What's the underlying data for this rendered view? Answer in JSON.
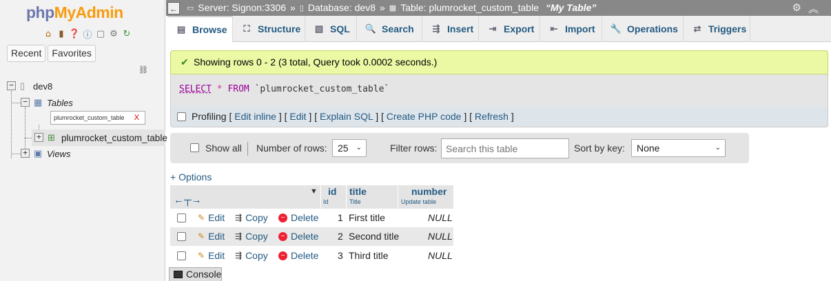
{
  "nav": {
    "logo_a": "php",
    "logo_b": "MyAdmin",
    "icons": [
      "home-icon",
      "logout-icon",
      "help-icon",
      "docs-icon",
      "copy-icon",
      "settings-icon",
      "reload-icon"
    ],
    "tab_recent": "Recent",
    "tab_favorites": "Favorites",
    "tree": {
      "db": "dev8",
      "tables_label": "Tables",
      "filter_value": "plumrocket_custom_table",
      "filter_clear": "X",
      "table_name": "plumrocket_custom_table",
      "views_label": "Views"
    }
  },
  "topbar": {
    "back": "←",
    "server": "Server: Signon:3306",
    "sep": "»",
    "database": "Database: dev8",
    "table": "Table: plumrocket_custom_table",
    "comment": "“My Table”"
  },
  "tabs": [
    {
      "label": "Browse",
      "icon": "browse-icon"
    },
    {
      "label": "Structure",
      "icon": "structure-icon"
    },
    {
      "label": "SQL",
      "icon": "sql-icon"
    },
    {
      "label": "Search",
      "icon": "search-icon"
    },
    {
      "label": "Insert",
      "icon": "insert-icon"
    },
    {
      "label": "Export",
      "icon": "export-icon"
    },
    {
      "label": "Import",
      "icon": "import-icon"
    },
    {
      "label": "Operations",
      "icon": "operations-icon"
    },
    {
      "label": "Triggers",
      "icon": "triggers-icon"
    }
  ],
  "message": "Showing rows 0 - 2 (3 total, Query took 0.0002 seconds.)",
  "sql": {
    "select": "SELECT",
    "star": "*",
    "from": "FROM",
    "table": "`plumrocket_custom_table`"
  },
  "profiling": {
    "label": "Profiling",
    "edit_inline": "Edit inline",
    "edit": "Edit",
    "explain": "Explain SQL",
    "php": "Create PHP code",
    "refresh": "Refresh"
  },
  "navbar": {
    "show_all": "Show all",
    "rows_label": "Number of rows:",
    "rows_value": "25",
    "filter_label": "Filter rows:",
    "filter_placeholder": "Search this table",
    "sort_label": "Sort by key:",
    "sort_value": "None"
  },
  "options_link": "+ Options",
  "results": {
    "columns": [
      {
        "name": "id",
        "comment": "Id"
      },
      {
        "name": "title",
        "comment": "Title"
      },
      {
        "name": "number",
        "comment": "Update table"
      }
    ],
    "actions": {
      "edit": "Edit",
      "copy": "Copy",
      "delete": "Delete"
    },
    "rows": [
      {
        "id": "1",
        "title": "First title",
        "number": "NULL"
      },
      {
        "id": "2",
        "title": "Second title",
        "number": "NULL"
      },
      {
        "id": "3",
        "title": "Third title",
        "number": "NULL"
      }
    ]
  },
  "console": "Console"
}
